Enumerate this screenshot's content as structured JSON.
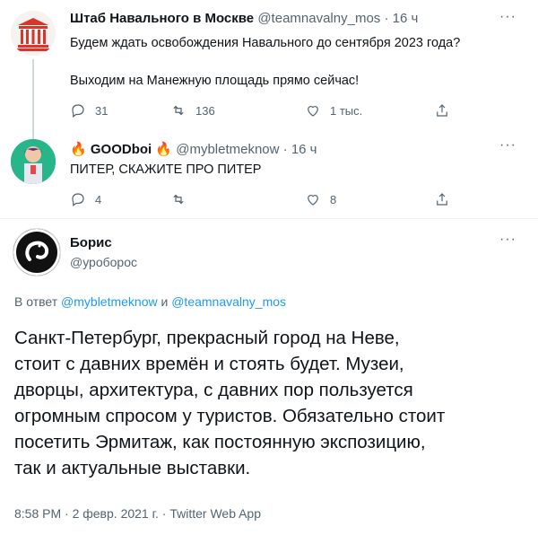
{
  "tweet1": {
    "author_name": "Штаб Навального в Москве",
    "handle": "@teamnavalny_mos",
    "time": "16 ч",
    "line1": "Будем ждать освобождения Навального до сентября 2023 года?",
    "line2": "Выходим на Манежную площадь прямо сейчас!",
    "replies": "31",
    "retweets": "136",
    "likes": "1 тыс."
  },
  "tweet2": {
    "author_name": "GOODboi",
    "handle": "@mybletmeknow",
    "time": "16 ч",
    "text": "ПИТЕР, СКАЖИТЕ ПРО ПИТЕР",
    "replies": "4",
    "retweets": "",
    "likes": "8"
  },
  "tweet3": {
    "author_name": "Борис",
    "handle": "@уроборос",
    "reply_prefix": "В ответ",
    "reply_to_1": "@mybletmeknow",
    "reply_and": "и",
    "reply_to_2": "@teamnavalny_mos",
    "text_lines": [
      "Санкт-Петербург, прекрасный город на Неве,",
      "стоит с давних времён и стоять будет. Музеи,",
      "дворцы, архитектура, с давних пор пользуется",
      "огромным спросом у туристов. Обязательно стоит",
      "посетить Эрмитаж, как постоянную экспозицию,",
      "так и актуальные выставки."
    ],
    "meta": "8:58 PM · 2 февр. 2021 г. · Twitter Web App"
  },
  "dot": "·",
  "more_glyph": "···",
  "colors": {
    "accent": "#1d9bf0",
    "muted": "#536471",
    "text": "#0f1419"
  },
  "icons": [
    "reply-icon",
    "retweet-icon",
    "like-icon",
    "share-icon",
    "more-icon",
    "fire-icon"
  ]
}
